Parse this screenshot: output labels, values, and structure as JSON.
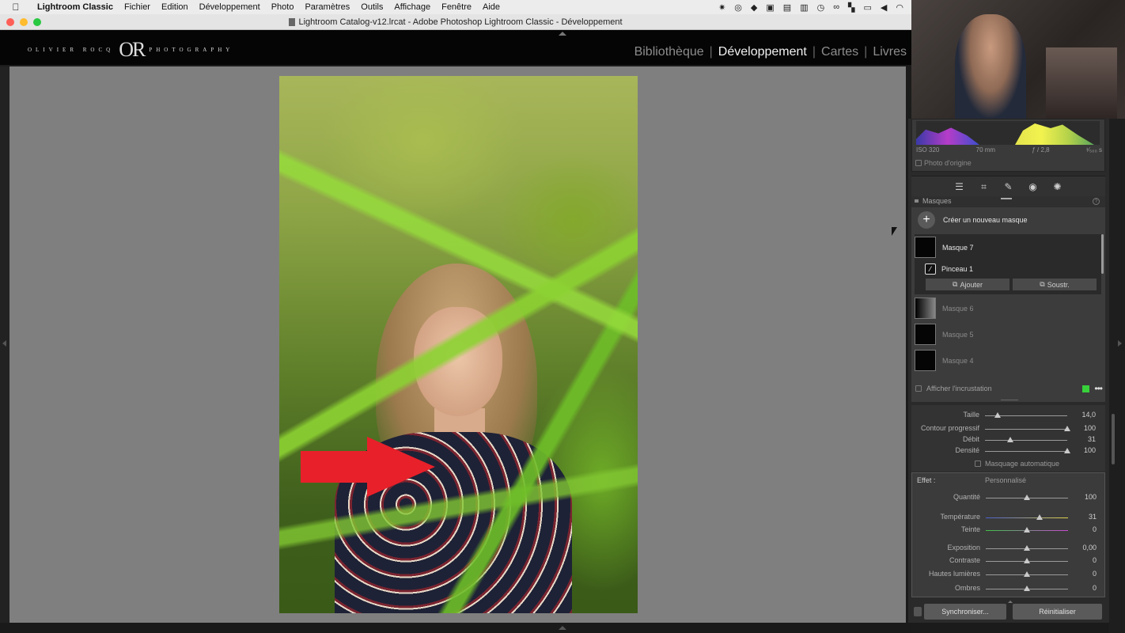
{
  "menubar": {
    "app_name": "Lightroom Classic",
    "items": [
      "Fichier",
      "Edition",
      "Développement",
      "Photo",
      "Paramètres",
      "Outils",
      "Affichage",
      "Fenêtre",
      "Aide"
    ]
  },
  "window": {
    "title": "Lightroom Catalog-v12.lrcat - Adobe Photoshop Lightroom Classic - Développement"
  },
  "identity_plate": {
    "name_text": "OLIVIER ROCQ",
    "monogram": "OR",
    "tag_text": "PHOTOGRAPHY"
  },
  "modules": {
    "items": [
      "Bibliothèque",
      "Développement",
      "Cartes",
      "Livres"
    ],
    "active": "Développement"
  },
  "histogram": {
    "iso": "ISO 320",
    "focal": "70 mm",
    "aperture": "ƒ / 2,8",
    "shutter": "¹⁄₅₀₀ s",
    "original_label": "Photo d'origine"
  },
  "masks": {
    "header": "Masques",
    "create_label": "Créer un nouveau masque",
    "active_mask": "Masque 7",
    "brush_label": "Pinceau 1",
    "add_label": "Ajouter",
    "subtract_label": "Soustr.",
    "other_masks": [
      "Masque 6",
      "Masque 5",
      "Masque 4"
    ],
    "overlay_label": "Afficher l'incrustation",
    "overlay_color": "#37d13a"
  },
  "brush": {
    "sliders": [
      {
        "label": "Taille",
        "value": "14,0",
        "level": 0.15
      },
      {
        "label": "Contour progressif",
        "value": "100",
        "level": 1.0
      },
      {
        "label": "Débit",
        "value": "31",
        "level": 0.31
      },
      {
        "label": "Densité",
        "value": "100",
        "level": 1.0
      }
    ],
    "automask_label": "Masquage automatique"
  },
  "effect": {
    "label": "Effet :",
    "preset": "Personnalisé",
    "sliders": [
      {
        "label": "Quantité",
        "value": "100",
        "level": 0.5
      },
      {
        "label": "Température",
        "value": "31",
        "level": 0.65
      },
      {
        "label": "Teinte",
        "value": "0",
        "level": 0.5
      },
      {
        "label": "Exposition",
        "value": "0,00",
        "level": 0.5
      },
      {
        "label": "Contraste",
        "value": "0",
        "level": 0.5
      },
      {
        "label": "Hautes lumières",
        "value": "0",
        "level": 0.5
      },
      {
        "label": "Ombres",
        "value": "0",
        "level": 0.5
      }
    ]
  },
  "footer": {
    "sync_label": "Synchroniser...",
    "reset_label": "Réinitialiser"
  }
}
